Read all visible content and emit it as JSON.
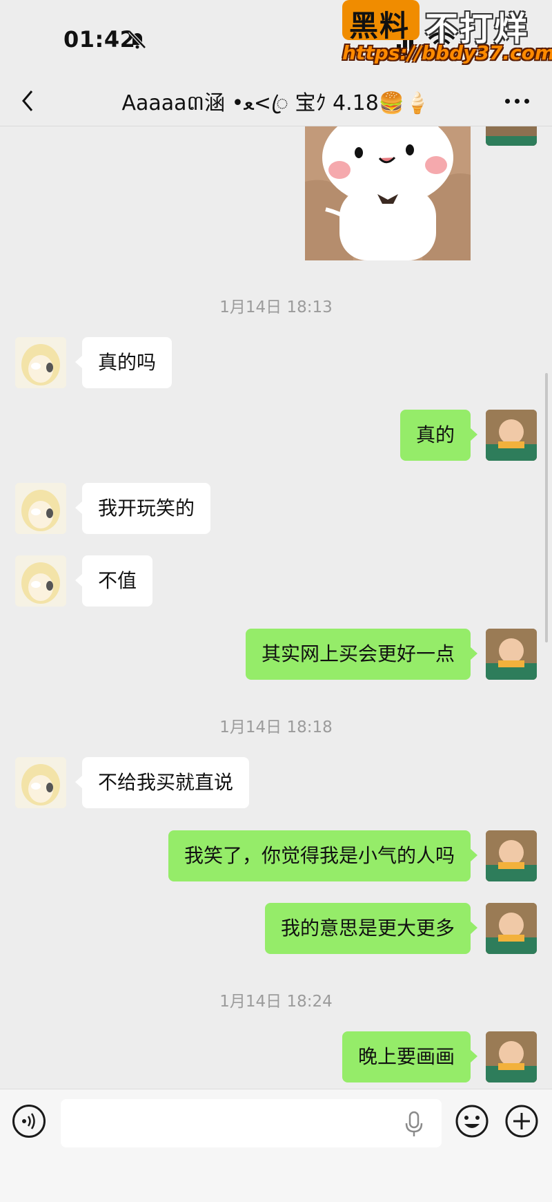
{
  "status_bar": {
    "time": "01:42"
  },
  "watermark": {
    "badge": "黑料",
    "title": "不打烊",
    "url": "https://bbdy37.com"
  },
  "header": {
    "title": "Aaaaa៣涵 •ﻌ<ꦿ 宝ｸ 4.18🍔🍦"
  },
  "messages": [
    {
      "type": "timestamp",
      "text": "1月14日 18:13"
    },
    {
      "side": "left",
      "text": "真的吗"
    },
    {
      "side": "right",
      "text": "真的"
    },
    {
      "side": "left",
      "text": "我开玩笑的"
    },
    {
      "side": "left",
      "text": "不值"
    },
    {
      "side": "right",
      "text": "其实网上买会更好一点"
    },
    {
      "type": "timestamp",
      "text": "1月14日 18:18"
    },
    {
      "side": "left",
      "text": "不给我买就直说"
    },
    {
      "side": "right",
      "text": "我笑了，你觉得我是小气的人吗"
    },
    {
      "side": "right",
      "text": "我的意思是更大更多"
    },
    {
      "type": "timestamp",
      "text": "1月14日 18:24"
    },
    {
      "side": "right",
      "text": "晚上要画画"
    }
  ],
  "input_bar": {
    "placeholder": ""
  },
  "icons": {
    "back": "chevron-left-icon",
    "more": "ellipsis-icon",
    "mute": "bell-slash-icon",
    "voice": "voice-icon",
    "mic": "microphone-icon",
    "emoji": "smiley-icon",
    "plus": "plus-icon"
  },
  "colors": {
    "background": "#ededed",
    "bubble_self": "#95ec69",
    "bubble_other": "#ffffff",
    "timestamp": "#9b9b9b"
  }
}
